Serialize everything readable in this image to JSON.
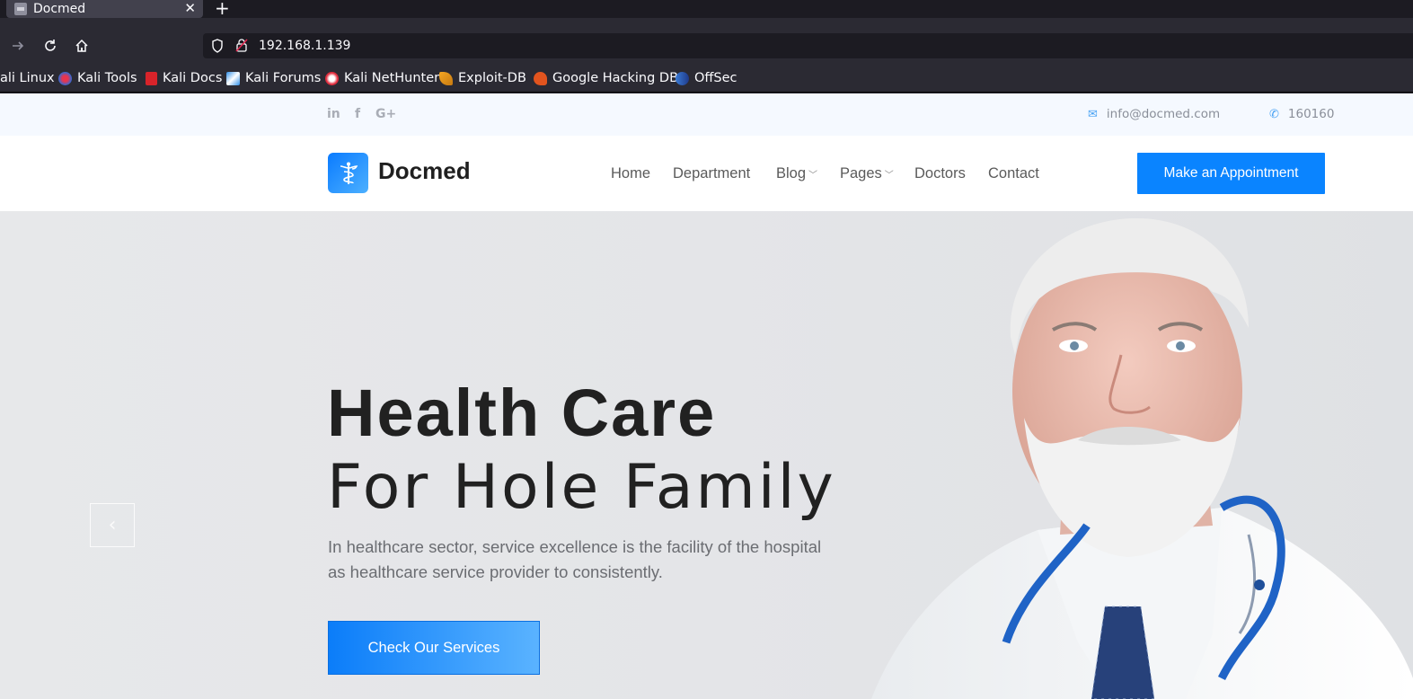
{
  "browser": {
    "tab_title": "Docmed",
    "url": "192.168.1.139",
    "bookmarks": [
      "ali Linux",
      "Kali Tools",
      "Kali Docs",
      "Kali Forums",
      "Kali NetHunter",
      "Exploit-DB",
      "Google Hacking DB",
      "OffSec"
    ]
  },
  "topbar": {
    "socials": [
      "in",
      "f",
      "G+"
    ],
    "email": "info@docmed.com",
    "phone": "160160"
  },
  "header": {
    "brand": "Docmed",
    "menu": [
      "Home",
      "Department",
      "Blog",
      "Pages",
      "Doctors",
      "Contact"
    ],
    "cta": "Make an Appointment"
  },
  "hero": {
    "title_line1": "Health Care",
    "title_line2": "For Hole Family",
    "subtitle": "In healthcare sector, service excellence is the facility of the hospital as healthcare service provider to consistently.",
    "button": "Check Our Services",
    "prev_arrow": "‹"
  },
  "colors": {
    "accent": "#0a84ff",
    "topbar_bg": "#f5f9ff",
    "hero_bg": "#e5e6e9"
  }
}
